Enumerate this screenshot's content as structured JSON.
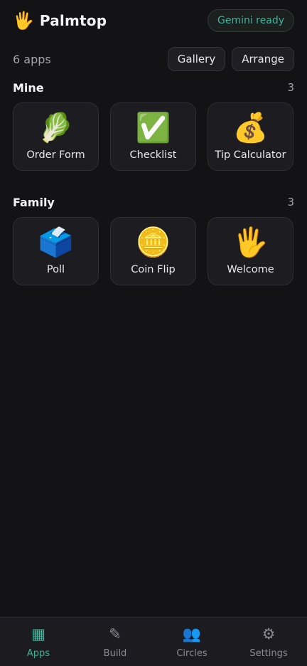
{
  "header": {
    "brand_icon": "🖐",
    "title": "Palmtop",
    "status": "Gemini ready"
  },
  "toolbar": {
    "app_count": "6 apps",
    "gallery_label": "Gallery",
    "arrange_label": "Arrange"
  },
  "sections": [
    {
      "title": "Mine",
      "count": "3",
      "apps": [
        {
          "icon": "🥬",
          "label": "Order Form"
        },
        {
          "icon": "✅",
          "label": "Checklist"
        },
        {
          "icon": "💰",
          "label": "Tip Calculator"
        }
      ]
    },
    {
      "title": "Family",
      "count": "3",
      "apps": [
        {
          "icon": "🗳️",
          "label": "Poll"
        },
        {
          "icon": "🪙",
          "label": "Coin Flip"
        },
        {
          "icon": "🖐",
          "label": "Welcome"
        }
      ]
    }
  ],
  "nav": {
    "active": "Apps",
    "items": [
      {
        "icon": "▦",
        "icon_name": "apps-grid-icon",
        "label": "Apps"
      },
      {
        "icon": "✎",
        "icon_name": "pencil-icon",
        "label": "Build"
      },
      {
        "icon": "👥",
        "icon_name": "people-icon",
        "label": "Circles"
      },
      {
        "icon": "⚙",
        "icon_name": "gear-icon",
        "label": "Settings"
      }
    ]
  },
  "colors": {
    "background": "#131316",
    "accent": "#3bb59b",
    "tile": "#1d1d21",
    "nav_background": "#1c1c20"
  }
}
